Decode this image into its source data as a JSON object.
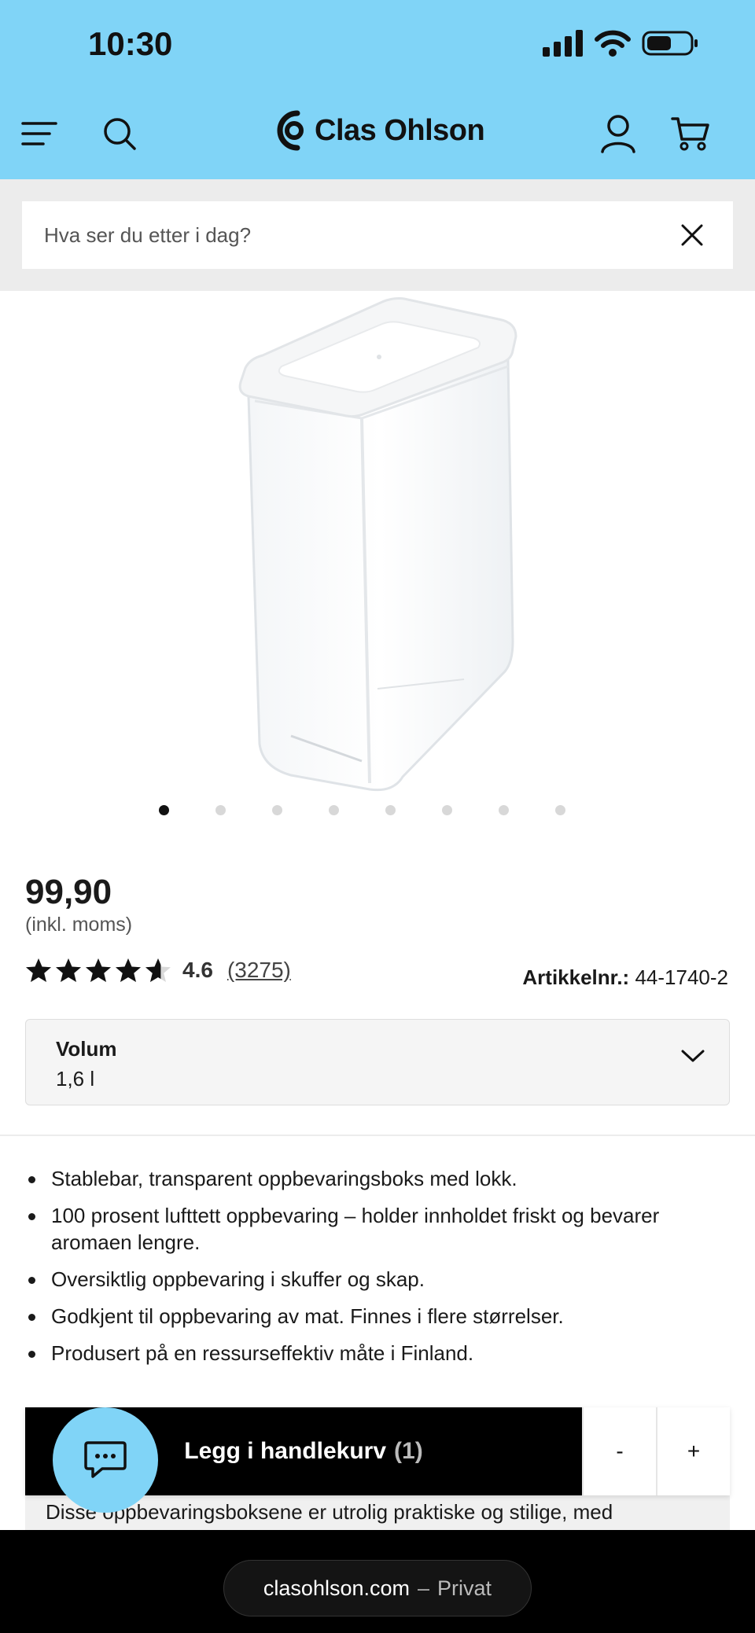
{
  "status_bar": {
    "time": "10:30"
  },
  "header": {
    "brand": "Clas Ohlson"
  },
  "search": {
    "placeholder": "Hva ser du etter i dag?"
  },
  "carousel": {
    "total": 8,
    "active_index": 0
  },
  "product": {
    "price": "99,90",
    "vat_note": "(inkl. moms)",
    "rating_value": "4.6",
    "rating_fill": 0.92,
    "rating_count": "(3275)",
    "article_label": "Artikkelnr.:",
    "article_number": "44-1740-2"
  },
  "volume": {
    "label": "Volum",
    "value": "1,6 l"
  },
  "features": [
    "Stablebar, transparent oppbevaringsboks med lokk.",
    "100 prosent lufttett oppbevaring – holder innholdet friskt og bevarer aromaen lengre.",
    "Oversiktlig oppbevaring i skuffer og skap.",
    "Godkjent til oppbevaring av mat. Finnes i flere størrelser.",
    "Produsert på en ressurseffektiv måte i Finland."
  ],
  "cart": {
    "add_label": "Legg i handlekurv",
    "quantity": "(1)",
    "minus": "-",
    "plus": "+"
  },
  "description_preview": "Disse oppbevaringsboksene er utrolig praktiske og stilige, med",
  "browser": {
    "domain": "clasohlson.com",
    "separator": "–",
    "mode": "Privat"
  }
}
